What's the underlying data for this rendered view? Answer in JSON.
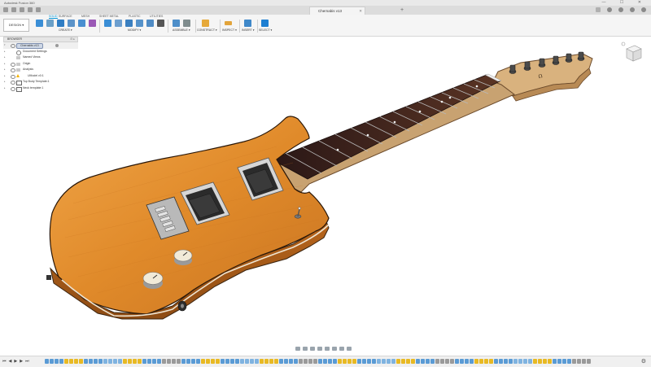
{
  "app_title": "Autodesk Fusion 360",
  "document_tab": "Chernabis v13",
  "design_button": "DESIGN",
  "tool_tabs": [
    "SOLID",
    "SURFACE",
    "MESH",
    "SHEET METAL",
    "PLASTIC",
    "UTILITIES"
  ],
  "groups": [
    "CREATE",
    "MODIFY",
    "ASSEMBLE",
    "CONSTRUCT",
    "INSPECT",
    "INSERT",
    "SELECT"
  ],
  "browser": {
    "title": "BROWSER",
    "root": "Chernabis v13",
    "items": [
      {
        "label": "Document Settings",
        "icon": "gear"
      },
      {
        "label": "Named Views",
        "icon": "folder"
      },
      {
        "label": "Origin",
        "icon": "folder"
      },
      {
        "label": "Analysis",
        "icon": "folder"
      },
      {
        "label": "UModel v0:1",
        "icon": "component",
        "warning": true
      },
      {
        "label": "Top Body Template:1",
        "icon": "component"
      },
      {
        "label": "Neck template:1",
        "icon": "component"
      }
    ]
  },
  "accent_color": "#0696d7",
  "body_color": "#e08a2a",
  "fretboard_color": "#3a2220"
}
